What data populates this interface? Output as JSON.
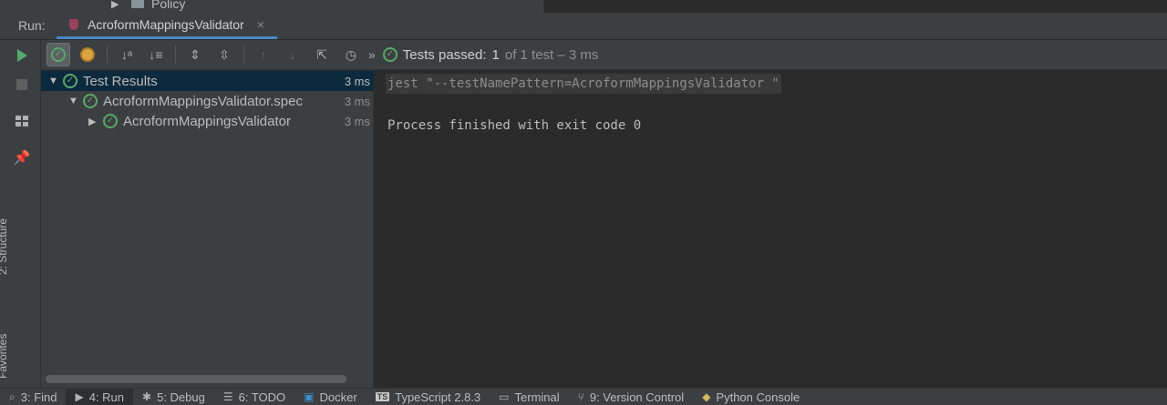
{
  "top": {
    "policy_label": "Policy"
  },
  "run_header": {
    "label": "Run:",
    "tab_label": "AcroformMappingsValidator",
    "close_glyph": "×"
  },
  "status": {
    "passed_label": "Tests passed:",
    "passed_count": "1",
    "of_label": "of 1 test – 3 ms"
  },
  "tree": {
    "root": {
      "label": "Test Results",
      "time": "3 ms"
    },
    "spec": {
      "label": "AcroformMappingsValidator.spec",
      "time": "3 ms"
    },
    "suite": {
      "label": "AcroformMappingsValidator",
      "time": "3 ms"
    }
  },
  "console": {
    "command": "jest \"--testNamePattern=AcroformMappingsValidator \"",
    "finished": "Process finished with exit code 0"
  },
  "left_tabs": {
    "structure": "2: Structure",
    "favorites": "Favorites"
  },
  "bottom_tabs": [
    {
      "label": "3: Find",
      "icon": "search-icon"
    },
    {
      "label": "4: Run",
      "icon": "run-icon"
    },
    {
      "label": "5: Debug",
      "icon": "bug-icon"
    },
    {
      "label": "6: TODO",
      "icon": "list-icon"
    },
    {
      "label": "Docker",
      "icon": "docker-icon"
    },
    {
      "label": "TypeScript 2.8.3",
      "icon": "typescript-icon"
    },
    {
      "label": "Terminal",
      "icon": "terminal-icon"
    },
    {
      "label": "9: Version Control",
      "icon": "vcs-icon"
    },
    {
      "label": "Python Console",
      "icon": "python-icon"
    }
  ],
  "colors": {
    "accent_green": "#59a869",
    "selection": "#0d293e",
    "background": "#2b2b2b",
    "panel": "#3c3f41"
  }
}
